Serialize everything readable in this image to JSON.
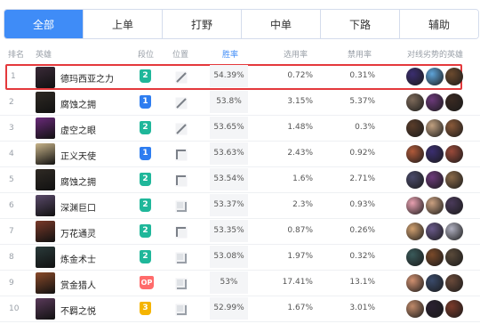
{
  "tabs": [
    "全部",
    "上单",
    "打野",
    "中单",
    "下路",
    "辅助"
  ],
  "active_tab": 0,
  "headers": {
    "rank": "排名",
    "hero": "英雄",
    "tier": "段位",
    "position": "位置",
    "win_rate": "胜率",
    "pick_rate": "选用率",
    "ban_rate": "禁用率",
    "counters": "对线劣势的英雄"
  },
  "colors": {
    "accent": "#3f8cf7",
    "highlight": "#e4393c",
    "tier_blue": "#2e7df0",
    "tier_green": "#1fb79a",
    "tier_red": "#ff6b6b",
    "tier_yellow": "#f5b400"
  },
  "rows": [
    {
      "rank": "1",
      "name": "德玛西亚之力",
      "tier": "2",
      "tier_color": "#1fb79a",
      "pos_icon": "slash",
      "win": "54.39%",
      "pick": "0.72%",
      "ban": "0.31%",
      "highlight": true,
      "avatar": "#3a2a38",
      "counters": [
        "#3b2e70",
        "#5ea3d8",
        "#6b4a2e"
      ]
    },
    {
      "rank": "2",
      "name": "腐蚀之拥",
      "tier": "1",
      "tier_color": "#2e7df0",
      "pos_icon": "slash",
      "win": "53.8%",
      "pick": "3.15%",
      "ban": "5.37%",
      "highlight": false,
      "avatar": "#2f2a24",
      "counters": [
        "#7d6a5a",
        "#6c3a7a",
        "#3a2a22"
      ]
    },
    {
      "rank": "3",
      "name": "虚空之眼",
      "tier": "2",
      "tier_color": "#1fb79a",
      "pos_icon": "slash",
      "win": "53.65%",
      "pick": "1.48%",
      "ban": "0.3%",
      "highlight": false,
      "avatar": "#6a2a7a",
      "counters": [
        "#5a3d2a",
        "#c0a080",
        "#8a5a3a"
      ]
    },
    {
      "rank": "4",
      "name": "正义天使",
      "tier": "1",
      "tier_color": "#2e7df0",
      "pos_icon": "corner",
      "win": "53.63%",
      "pick": "2.43%",
      "ban": "0.92%",
      "highlight": false,
      "avatar": "#c8b48a",
      "counters": [
        "#b05a3a",
        "#3b2e70",
        "#9a4a3a"
      ]
    },
    {
      "rank": "5",
      "name": "腐蚀之拥",
      "tier": "2",
      "tier_color": "#1fb79a",
      "pos_icon": "corner",
      "win": "53.54%",
      "pick": "1.6%",
      "ban": "2.71%",
      "highlight": false,
      "avatar": "#2f2a24",
      "counters": [
        "#4a4a6a",
        "#6c3a7a",
        "#8a6a4a"
      ]
    },
    {
      "rank": "6",
      "name": "深渊巨口",
      "tier": "2",
      "tier_color": "#1fb79a",
      "pos_icon": "corner-box",
      "win": "53.37%",
      "pick": "2.3%",
      "ban": "0.93%",
      "highlight": false,
      "avatar": "#5a4a6a",
      "counters": [
        "#e8a0b0",
        "#caa080",
        "#4a3a5a"
      ]
    },
    {
      "rank": "7",
      "name": "万花通灵",
      "tier": "2",
      "tier_color": "#1fb79a",
      "pos_icon": "corner",
      "win": "53.35%",
      "pick": "0.87%",
      "ban": "0.26%",
      "highlight": false,
      "avatar": "#7a3a2a",
      "counters": [
        "#d0a070",
        "#6a5a8a",
        "#b0b0c0"
      ]
    },
    {
      "rank": "8",
      "name": "炼金术士",
      "tier": "2",
      "tier_color": "#1fb79a",
      "pos_icon": "corner-box",
      "win": "53.08%",
      "pick": "1.97%",
      "ban": "0.32%",
      "highlight": false,
      "avatar": "#2a3a3a",
      "counters": [
        "#3a5a5a",
        "#7a4a2a",
        "#5a4a3a"
      ]
    },
    {
      "rank": "9",
      "name": "赏金猎人",
      "tier": "OP",
      "tier_color": "#ff6b6b",
      "pos_icon": "corner-box",
      "win": "53%",
      "pick": "17.41%",
      "ban": "13.1%",
      "highlight": false,
      "avatar": "#8a4a2a",
      "counters": [
        "#d09070",
        "#3a4a6a",
        "#6a4a3a"
      ]
    },
    {
      "rank": "10",
      "name": "不羁之悦",
      "tier": "3",
      "tier_color": "#f5b400",
      "pos_icon": "corner-box",
      "win": "52.99%",
      "pick": "1.67%",
      "ban": "3.01%",
      "highlight": false,
      "avatar": "#5a3a5a",
      "counters": [
        "#c08a6a",
        "#2a2030",
        "#7a3a2a"
      ]
    }
  ]
}
